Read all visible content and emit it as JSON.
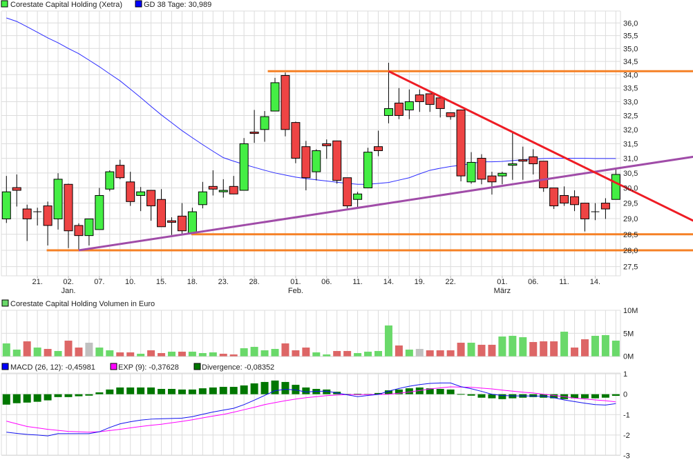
{
  "chart_data": [
    {
      "type": "candlestick",
      "title": "Corestate Capital Holding (Xetra)",
      "legend": [
        {
          "label": "Corestate Capital Holding (Xetra)",
          "color": "#44ee44"
        },
        {
          "label": "GD 38 Tage: 30,989",
          "color": "#0000ff"
        }
      ],
      "yscale": "log",
      "ylim": [
        27.2,
        36.3
      ],
      "yticks": [
        {
          "v": 36.0,
          "label": "36,0"
        },
        {
          "v": 35.5,
          "label": "35,5"
        },
        {
          "v": 35.0,
          "label": "35,0"
        },
        {
          "v": 34.5,
          "label": "34,5"
        },
        {
          "v": 34.0,
          "label": "34,0"
        },
        {
          "v": 33.5,
          "label": "33,5"
        },
        {
          "v": 33.0,
          "label": "33,0"
        },
        {
          "v": 32.5,
          "label": "32,5"
        },
        {
          "v": 32.0,
          "label": "32,0"
        },
        {
          "v": 31.5,
          "label": "31,5"
        },
        {
          "v": 31.0,
          "label": "31,0"
        },
        {
          "v": 30.5,
          "label": "30,5"
        },
        {
          "v": 30.0,
          "label": "30,0"
        },
        {
          "v": 29.5,
          "label": "29,5"
        },
        {
          "v": 29.0,
          "label": "29,0"
        },
        {
          "v": 28.5,
          "label": "28,5"
        },
        {
          "v": 28.0,
          "label": "28,0"
        },
        {
          "v": 27.5,
          "label": "27,5"
        }
      ],
      "xticks": [
        {
          "i": 3,
          "label": "21."
        },
        {
          "i": 6,
          "label": "02.",
          "month": "Jan."
        },
        {
          "i": 9,
          "label": "07."
        },
        {
          "i": 12,
          "label": "10."
        },
        {
          "i": 15,
          "label": "15."
        },
        {
          "i": 18,
          "label": "18."
        },
        {
          "i": 21,
          "label": "23."
        },
        {
          "i": 24,
          "label": "28."
        },
        {
          "i": 28,
          "label": "01.",
          "month": "Feb."
        },
        {
          "i": 31,
          "label": "06."
        },
        {
          "i": 34,
          "label": "11."
        },
        {
          "i": 37,
          "label": "14."
        },
        {
          "i": 40,
          "label": "19."
        },
        {
          "i": 43,
          "label": "22."
        },
        {
          "i": 48,
          "label": "01.",
          "month": "März"
        },
        {
          "i": 51,
          "label": "06."
        },
        {
          "i": 54,
          "label": "11."
        },
        {
          "i": 57,
          "label": "14."
        }
      ],
      "ohlc": [
        [
          28.99,
          30.4,
          28.86,
          29.87
        ],
        [
          30.01,
          30.45,
          29.39,
          29.92
        ],
        [
          29.31,
          29.45,
          28.29,
          28.99
        ],
        [
          29.22,
          29.35,
          28.78,
          29.22
        ],
        [
          29.41,
          29.55,
          28.15,
          28.78
        ],
        [
          28.99,
          30.49,
          28.65,
          30.29
        ],
        [
          30.12,
          30.14,
          28.07,
          28.61
        ],
        [
          28.78,
          28.85,
          28.0,
          28.46
        ],
        [
          28.46,
          28.99,
          28.15,
          28.99
        ],
        [
          28.65,
          30.0,
          28.65,
          29.75
        ],
        [
          29.96,
          30.59,
          29.89,
          30.54
        ],
        [
          30.76,
          30.95,
          30.29,
          30.34
        ],
        [
          30.2,
          30.54,
          29.41,
          29.55
        ],
        [
          29.75,
          30.03,
          29.24,
          29.87
        ],
        [
          29.92,
          29.92,
          28.93,
          29.41
        ],
        [
          29.62,
          29.96,
          28.74,
          28.74
        ],
        [
          28.93,
          29.04,
          28.48,
          28.88
        ],
        [
          29.08,
          29.5,
          28.48,
          28.61
        ],
        [
          28.54,
          29.35,
          28.54,
          29.22
        ],
        [
          29.45,
          30.2,
          29.33,
          29.87
        ],
        [
          30.05,
          30.59,
          29.75,
          29.96
        ],
        [
          29.87,
          30.29,
          29.68,
          29.92
        ],
        [
          30.05,
          30.4,
          29.8,
          29.8
        ],
        [
          29.92,
          31.7,
          29.92,
          31.5
        ],
        [
          31.91,
          32.7,
          31.53,
          31.86
        ],
        [
          32.0,
          32.66,
          31.57,
          32.46
        ],
        [
          32.66,
          33.88,
          32.66,
          33.7
        ],
        [
          33.97,
          34.08,
          31.76,
          32.0
        ],
        [
          32.25,
          32.28,
          30.83,
          31.0
        ],
        [
          31.4,
          31.6,
          29.92,
          30.34
        ],
        [
          30.54,
          31.31,
          30.25,
          31.26
        ],
        [
          31.5,
          31.65,
          30.98,
          31.43
        ],
        [
          31.6,
          31.6,
          30.14,
          30.25
        ],
        [
          30.34,
          30.34,
          29.33,
          29.41
        ],
        [
          29.62,
          29.87,
          29.35,
          29.8
        ],
        [
          30.0,
          31.36,
          30.0,
          31.21
        ],
        [
          31.4,
          31.96,
          31.07,
          31.26
        ],
        [
          32.5,
          34.45,
          32.22,
          32.75
        ],
        [
          32.95,
          33.5,
          32.37,
          32.5
        ],
        [
          32.7,
          33.45,
          32.37,
          33.0
        ],
        [
          33.25,
          33.45,
          32.63,
          33.0
        ],
        [
          33.29,
          33.29,
          32.63,
          32.9
        ],
        [
          33.14,
          33.14,
          32.43,
          32.75
        ],
        [
          32.6,
          32.6,
          32.35,
          32.46
        ],
        [
          32.7,
          32.7,
          30.22,
          30.4
        ],
        [
          30.2,
          31.21,
          30.14,
          30.86
        ],
        [
          31.0,
          31.14,
          30.12,
          30.29
        ],
        [
          30.4,
          30.54,
          29.78,
          30.2
        ],
        [
          30.4,
          30.54,
          30.12,
          30.49
        ],
        [
          30.76,
          31.88,
          30.27,
          30.81
        ],
        [
          30.95,
          31.4,
          30.27,
          30.9
        ],
        [
          31.05,
          31.31,
          30.45,
          30.81
        ],
        [
          30.9,
          30.9,
          29.87,
          30.0
        ],
        [
          30.0,
          30.0,
          29.31,
          29.41
        ],
        [
          29.75,
          30.05,
          29.41,
          29.5
        ],
        [
          29.71,
          29.92,
          29.24,
          29.45
        ],
        [
          29.5,
          29.5,
          28.59,
          28.99
        ],
        [
          29.22,
          29.5,
          28.95,
          29.22
        ],
        [
          29.5,
          29.66,
          28.99,
          29.31
        ],
        [
          29.62,
          30.67,
          29.62,
          30.45
        ]
      ],
      "ma38": [
        36.2,
        36.06,
        35.85,
        35.63,
        35.41,
        35.22,
        35.0,
        34.8,
        34.55,
        34.3,
        34.03,
        33.77,
        33.46,
        33.15,
        32.83,
        32.52,
        32.24,
        31.96,
        31.71,
        31.47,
        31.24,
        31.02,
        30.9,
        30.79,
        30.69,
        30.59,
        30.5,
        30.43,
        30.36,
        30.31,
        30.27,
        30.23,
        30.19,
        30.15,
        30.12,
        30.12,
        30.15,
        30.18,
        30.26,
        30.34,
        30.47,
        30.59,
        30.66,
        30.72,
        30.76,
        30.82,
        30.88,
        30.88,
        30.89,
        30.92,
        30.95,
        30.97,
        30.99,
        31.0,
        31.0,
        31.0,
        31.0,
        30.99,
        30.99,
        30.99
      ],
      "hlines": [
        {
          "price": 34.13,
          "from_index": 25.3,
          "color": "#f58025"
        },
        {
          "price": 28.5,
          "from_index": 17.9,
          "color": "#f58025"
        },
        {
          "price": 28.0,
          "from_index": 3.9,
          "color": "#f58025"
        }
      ],
      "trendlines": [
        {
          "from": [
            7,
            28.0
          ],
          "to": [
            66.5,
            31.05
          ],
          "color": "#a04ca8"
        },
        {
          "from": [
            37,
            34.13
          ],
          "to": [
            66.5,
            28.93
          ],
          "color": "#ee1c24"
        }
      ]
    },
    {
      "type": "bar",
      "title": "Corestate Capital Holding Volumen in Euro",
      "ylim": [
        0,
        10
      ],
      "yticks": [
        {
          "v": 10,
          "label": "10M"
        },
        {
          "v": 5,
          "label": "5M"
        },
        {
          "v": 0,
          "label": "0M"
        }
      ],
      "unit": "M EUR",
      "values": [
        2.8,
        1.45,
        3.25,
        1.9,
        1.6,
        1.15,
        3.4,
        1.9,
        2.95,
        1.9,
        1.3,
        0.85,
        0.85,
        0.55,
        1.3,
        0.7,
        1.0,
        1.0,
        1.0,
        0.7,
        0.85,
        0.55,
        0.4,
        1.75,
        2.05,
        1.3,
        1.6,
        2.8,
        1.3,
        1.9,
        0.85,
        0.4,
        1.15,
        1.15,
        0.7,
        1.0,
        1.15,
        6.7,
        2.35,
        1.45,
        1.6,
        1.3,
        1.3,
        1.3,
        2.95,
        2.95,
        2.5,
        2.5,
        4.3,
        4.45,
        4.15,
        3.1,
        3.25,
        3.25,
        5.35,
        1.9,
        3.7,
        4.45,
        4.6,
        3.4
      ],
      "colors": "ggrgrgrrxggrrgrrgrggg rrgggg rrrggrrggggrgxrrrrgrrgggrrrgrrggg",
      "color_list": [
        "g",
        "g",
        "r",
        "g",
        "r",
        "g",
        "r",
        "r",
        "x",
        "g",
        "g",
        "r",
        "r",
        "g",
        "r",
        "r",
        "g",
        "r",
        "g",
        "g",
        "g",
        "r",
        "r",
        "g",
        "g",
        "g",
        "g",
        "r",
        "r",
        "r",
        "g",
        "g",
        "r",
        "r",
        "g",
        "g",
        "g",
        "g",
        "r",
        "g",
        "x",
        "r",
        "r",
        "r",
        "r",
        "g",
        "r",
        "r",
        "g",
        "g",
        "g",
        "r",
        "r",
        "r",
        "g",
        "r",
        "r",
        "g",
        "g",
        "g"
      ]
    },
    {
      "type": "line",
      "title": "MACD",
      "legend": [
        {
          "label": "MACD (26, 12): -0,45981",
          "color": "#0000ff"
        },
        {
          "label": "EXP (9): -0,37628",
          "color": "#ff00ff"
        },
        {
          "label": "Divergence: -0,08352",
          "color": "#007700"
        }
      ],
      "ylim": [
        -3,
        1
      ],
      "yticks": [
        {
          "v": 1,
          "label": "1"
        },
        {
          "v": 0,
          "label": "0"
        },
        {
          "v": -1,
          "label": "-1"
        },
        {
          "v": -2,
          "label": "-2"
        },
        {
          "v": -3,
          "label": "-3"
        }
      ],
      "macd": [
        -1.86,
        -1.92,
        -1.97,
        -2.0,
        -2.04,
        -1.93,
        -1.93,
        -1.93,
        -1.93,
        -1.84,
        -1.63,
        -1.45,
        -1.35,
        -1.27,
        -1.22,
        -1.2,
        -1.19,
        -1.17,
        -1.1,
        -0.98,
        -0.87,
        -0.78,
        -0.69,
        -0.51,
        -0.29,
        -0.06,
        0.17,
        0.24,
        0.21,
        0.11,
        0.14,
        0.15,
        0.06,
        -0.03,
        -0.12,
        -0.06,
        -0.01,
        0.15,
        0.28,
        0.39,
        0.47,
        0.53,
        0.55,
        0.55,
        0.37,
        0.27,
        0.14,
        0.0,
        -0.06,
        -0.08,
        -0.08,
        -0.09,
        -0.09,
        -0.17,
        -0.28,
        -0.36,
        -0.44,
        -0.51,
        -0.53,
        -0.46
      ],
      "exp": [
        -1.32,
        -1.45,
        -1.58,
        -1.65,
        -1.72,
        -1.77,
        -1.82,
        -1.84,
        -1.86,
        -1.84,
        -1.78,
        -1.72,
        -1.65,
        -1.58,
        -1.52,
        -1.47,
        -1.4,
        -1.33,
        -1.25,
        -1.16,
        -1.07,
        -0.99,
        -0.88,
        -0.76,
        -0.64,
        -0.51,
        -0.41,
        -0.32,
        -0.24,
        -0.17,
        -0.12,
        -0.07,
        -0.04,
        -0.02,
        -0.02,
        -0.02,
        -0.01,
        0.0,
        0.05,
        0.11,
        0.18,
        0.26,
        0.31,
        0.36,
        0.35,
        0.34,
        0.3,
        0.26,
        0.2,
        0.15,
        0.1,
        0.06,
        0.0,
        -0.06,
        -0.12,
        -0.19,
        -0.23,
        -0.28,
        -0.32,
        -0.376
      ],
      "divergence": [
        -0.51,
        -0.44,
        -0.41,
        -0.37,
        -0.3,
        -0.14,
        -0.14,
        -0.1,
        -0.07,
        0.09,
        0.23,
        0.33,
        0.33,
        0.33,
        0.33,
        0.26,
        0.26,
        0.23,
        0.23,
        0.29,
        0.33,
        0.36,
        0.36,
        0.43,
        0.53,
        0.6,
        0.67,
        0.6,
        0.46,
        0.33,
        0.26,
        0.23,
        0.12,
        0.01,
        0.02,
        0.01,
        0.06,
        0.19,
        0.23,
        0.29,
        0.33,
        0.29,
        0.26,
        0.23,
        0.01,
        -0.07,
        -0.17,
        -0.2,
        -0.24,
        -0.2,
        -0.17,
        -0.14,
        -0.17,
        -0.2,
        -0.24,
        -0.2,
        -0.2,
        -0.2,
        -0.17,
        -0.08
      ]
    }
  ]
}
